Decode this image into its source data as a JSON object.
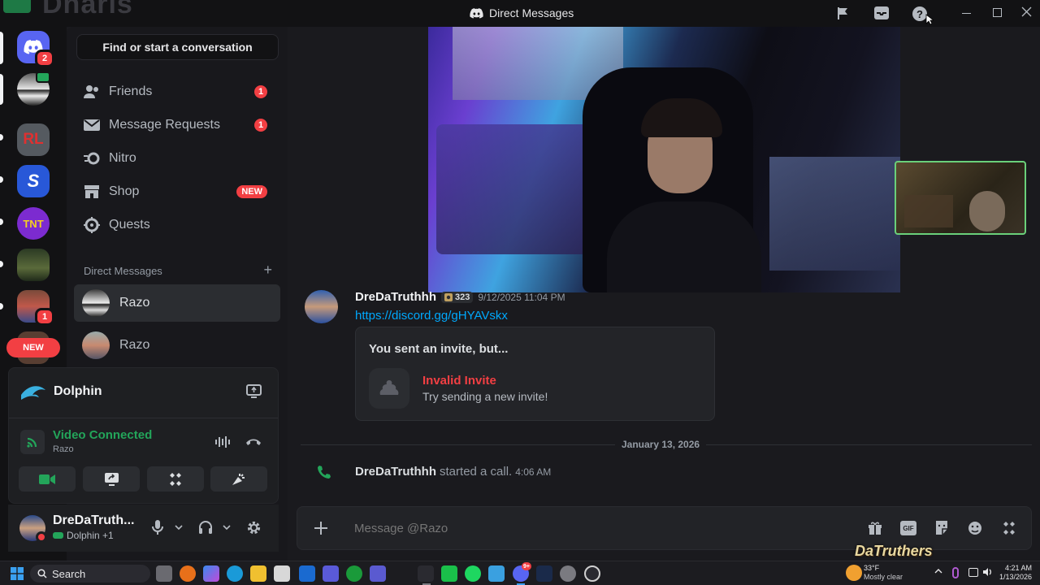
{
  "window": {
    "title": "Direct Messages",
    "faded_logo_text": "Dnaris"
  },
  "rail": {
    "home_badge": "2",
    "server_badge": "1",
    "new_label": "NEW",
    "server_letters": [
      "RL",
      "S",
      "TNT"
    ]
  },
  "sidebar": {
    "search_label": "Find or start a conversation",
    "nav": [
      {
        "label": "Friends",
        "count": "1"
      },
      {
        "label": "Message Requests",
        "count": "1"
      },
      {
        "label": "Nitro",
        "count": ""
      },
      {
        "label": "Shop",
        "tag": "NEW"
      },
      {
        "label": "Quests",
        "count": ""
      }
    ],
    "dm_header": "Direct Messages",
    "dm_add": "+",
    "dms": [
      {
        "name": "Razo"
      },
      {
        "name": "Razo"
      }
    ]
  },
  "voice": {
    "activity": "Dolphin",
    "status": "Video Connected",
    "channel": "Razo"
  },
  "user": {
    "name": "DreDaTruth...",
    "activity": "Dolphin +1"
  },
  "messages": {
    "author": "DreDaTruthhh",
    "tag": "323",
    "timestamp": "9/12/2025 11:04 PM",
    "link": "https://discord.gg/gHYAVskx",
    "invite_heading": "You sent an invite, but...",
    "invite_title": "Invalid Invite",
    "invite_sub": "Try sending a new invite!",
    "divider_date": "January 13, 2026",
    "call_author": "DreDaTruthhh",
    "call_text": "started a call.",
    "call_time": "4:06 AM"
  },
  "composer": {
    "placeholder": "Message @Razo"
  },
  "stream_overlay": {
    "watermark": "DaTruthers"
  },
  "taskbar": {
    "search_label": "Search",
    "weather_temp": "33°F",
    "weather_desc": "Mostly clear",
    "time": "4:21 AM",
    "date": "1/13/2026",
    "discord_badge": "9+"
  },
  "colors": {
    "accent": "#5865f2",
    "danger": "#f23f43",
    "online": "#23a55a",
    "link": "#00a8fc"
  }
}
